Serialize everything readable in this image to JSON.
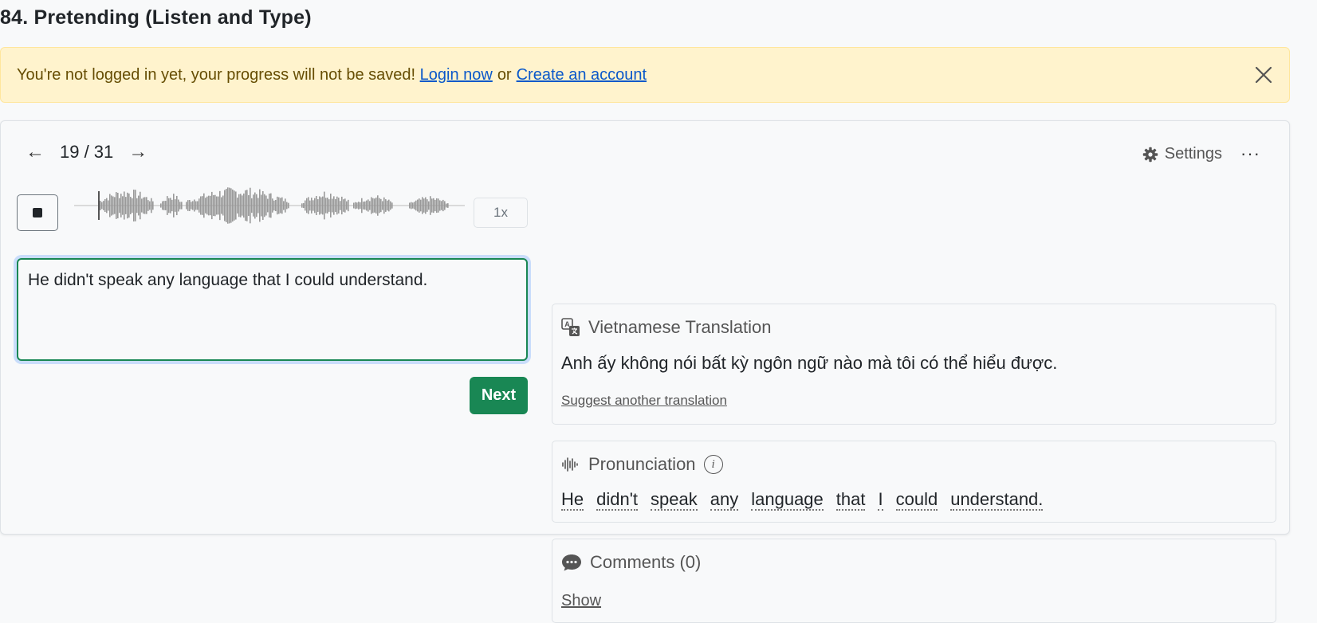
{
  "page": {
    "title": "84. Pretending (Listen and Type)"
  },
  "alert": {
    "message": "You're not logged in yet, your progress will not be saved!",
    "login_label": "Login now",
    "or_label": "or",
    "create_label": "Create an account"
  },
  "nav": {
    "prev_icon": "arrow-left-icon",
    "counter": "19 / 31",
    "next_icon": "arrow-right-icon"
  },
  "toolbar": {
    "settings_label": "Settings",
    "more_label": "···"
  },
  "player": {
    "speed_label": "1x"
  },
  "answer": {
    "value": "He didn't speak any language that I could understand."
  },
  "next_label": "Next",
  "translation": {
    "title": "Vietnamese Translation",
    "text": "Anh ấy không nói bất kỳ ngôn ngữ nào mà tôi có thể hiểu được.",
    "suggest_label": "Suggest another translation"
  },
  "pronunciation": {
    "title": "Pronunciation",
    "info_label": "i",
    "words": [
      "He",
      "didn't",
      "speak",
      "any",
      "language",
      "that",
      "I",
      "could",
      "understand."
    ]
  },
  "comments": {
    "title": "Comments (0)",
    "show_label": "Show"
  },
  "colors": {
    "accent": "#198754",
    "alert_bg": "#fff3cd",
    "link": "#0a58ca"
  }
}
